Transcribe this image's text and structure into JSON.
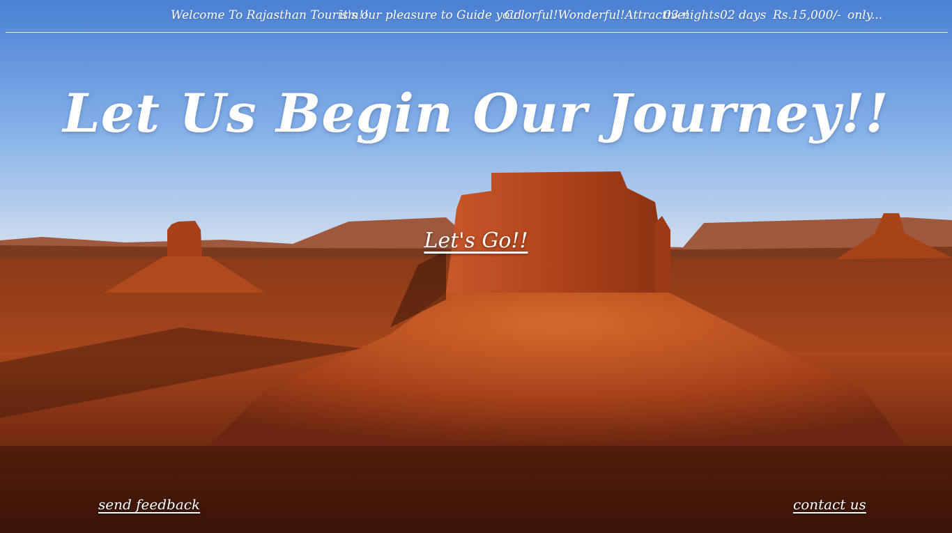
{
  "colors": {
    "sky_top": "#4f86d6",
    "sky_mid": "#8ab6ec",
    "horizon": "#c9d8ec",
    "rock_main": "#b5441c",
    "rock_light": "#d8702e",
    "ground_dark": "#3a1408",
    "text": "#ffffff"
  },
  "topbar": {
    "welcome": "Welcome To Rajasthan Tourism!!",
    "pleasure": "it's our pleasure to Guide you!",
    "tagline": "Colorful!Wonderful!Attractive!",
    "nights": "03 nights",
    "days": "02 days",
    "price": "Rs.15,000/-",
    "only": "only..."
  },
  "hero": {
    "headline": "Let Us Begin Our Journey!!",
    "cta_label": "Let's Go!!"
  },
  "footer": {
    "feedback_label": "send feedback",
    "contact_label": "contact us"
  }
}
